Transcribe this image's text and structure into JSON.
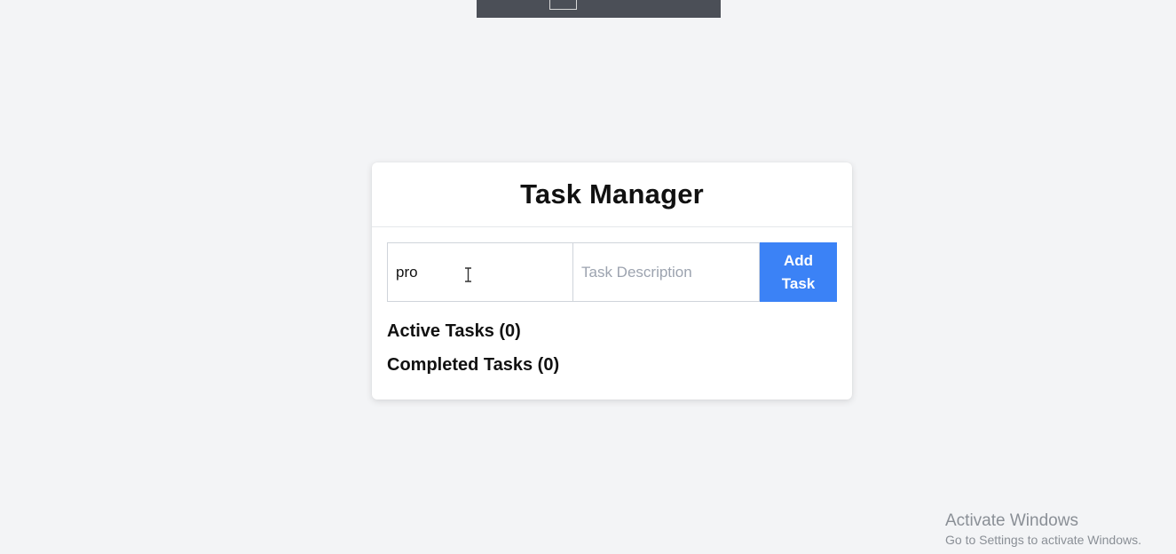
{
  "app": {
    "title": "Task Manager"
  },
  "form": {
    "title_input": {
      "value": "pro"
    },
    "description_input": {
      "placeholder": "Task Description",
      "value": ""
    },
    "add_button_label": "Add Task"
  },
  "sections": {
    "active_label": "Active Tasks (0)",
    "completed_label": "Completed Tasks (0)"
  },
  "watermark": {
    "title": "Activate Windows",
    "subtitle": "Go to Settings to activate Windows."
  },
  "colors": {
    "accent": "#3b82f6",
    "background": "#f3f4f6",
    "card": "#ffffff"
  },
  "icons": {
    "pointer": "text-cursor-icon"
  }
}
